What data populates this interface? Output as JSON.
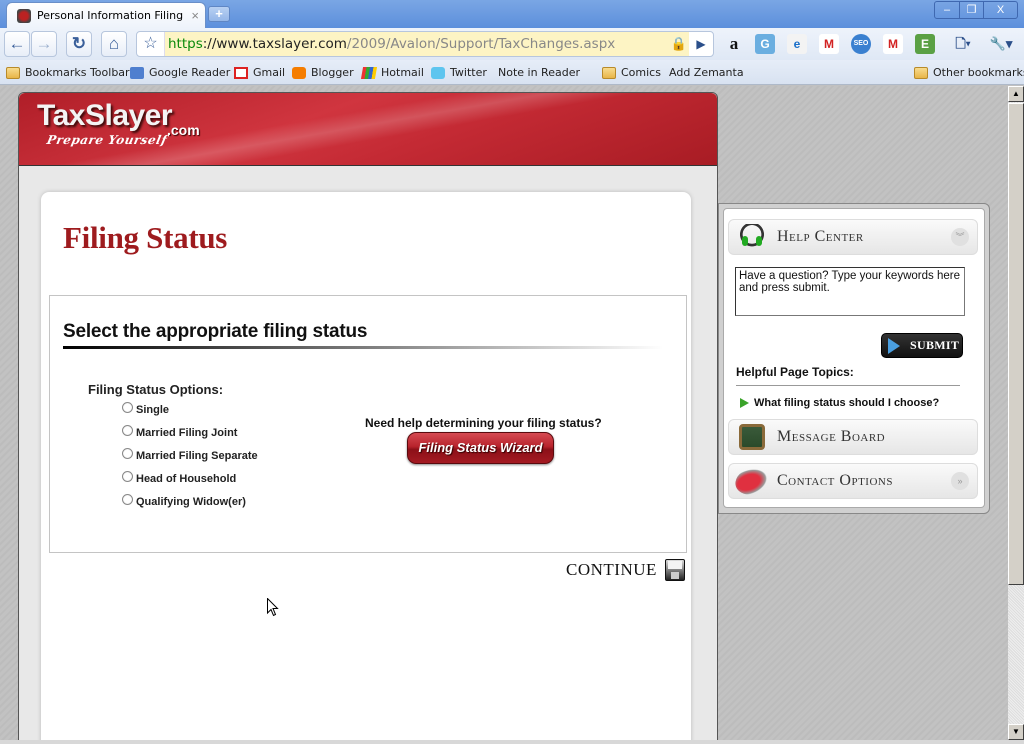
{
  "browser": {
    "tab_title": "Personal Information Filing ...",
    "tab_close": "×",
    "new_tab": "+",
    "window_controls": {
      "minimize": "–",
      "restore": "❐",
      "close": "X"
    },
    "nav": {
      "back": "←",
      "forward": "→",
      "reload": "↻",
      "home": "⌂"
    },
    "bookmark_star": "☆",
    "url": {
      "scheme": "https",
      "host": "://www.taxslayer.com",
      "path": "/2009/Avalon/Support/TaxChanges.aspx"
    },
    "lock": "🔒",
    "go": "▶",
    "extensions": [
      {
        "name": "amazon",
        "glyph": "a",
        "color": "#111111",
        "bg": "transparent"
      },
      {
        "name": "google-reader",
        "glyph": "G",
        "color": "#ffffff",
        "bg": "#6aaee0"
      },
      {
        "name": "ie-tab",
        "glyph": "e",
        "color": "#1a6fc9",
        "bg": "#f3f3f3"
      },
      {
        "name": "gmail-checker",
        "glyph": "M",
        "color": "#d22222",
        "bg": "#ffffff"
      },
      {
        "name": "seo",
        "glyph": "SEO",
        "color": "#ffffff",
        "bg": "#3a80d0"
      },
      {
        "name": "gmail-notifier",
        "glyph": "M",
        "color": "#d22222",
        "bg": "#ffffff"
      },
      {
        "name": "evernote",
        "glyph": "E",
        "color": "#ffffff",
        "bg": "#5aa044"
      },
      {
        "name": "page-menu",
        "glyph": "🗋▾",
        "color": "#2b4f8a",
        "bg": "transparent"
      },
      {
        "name": "wrench-menu",
        "glyph": "🔧▾",
        "color": "#2b4f8a",
        "bg": "transparent"
      }
    ],
    "bookmarks": [
      {
        "label": "Bookmarks Toolbar",
        "icon": "folder"
      },
      {
        "label": "Google Reader",
        "icon": "rss"
      },
      {
        "label": "Gmail",
        "icon": "gmail"
      },
      {
        "label": "Blogger",
        "icon": "blogger"
      },
      {
        "label": "Hotmail",
        "icon": "hotmail"
      },
      {
        "label": "Twitter",
        "icon": "twitter"
      },
      {
        "label": "Note in Reader",
        "icon": "page"
      },
      {
        "label": "Comics",
        "icon": "folder"
      },
      {
        "label": "Add Zemanta",
        "icon": "page"
      }
    ],
    "other_bookmarks": "Other bookmarks",
    "scrollbar": {
      "up": "▲",
      "down": "▼"
    }
  },
  "site": {
    "logo": {
      "name": "TaxSlayer",
      "domain": ".com",
      "tagline": "Prepare Yourself"
    },
    "page_title": "Filing Status",
    "section_heading": "Select the appropriate filing status",
    "options_label": "Filing Status Options:",
    "options": [
      {
        "label": "Single",
        "selected": false
      },
      {
        "label": "Married Filing Joint",
        "selected": false
      },
      {
        "label": "Married Filing Separate",
        "selected": false
      },
      {
        "label": "Head of Household",
        "selected": false
      },
      {
        "label": "Qualifying Widow(er)",
        "selected": false
      }
    ],
    "help_question": "Need help determining your filing status?",
    "wizard_button": "Filing Status Wizard",
    "continue_label": "CONTINUE",
    "brand_color": "#9e1b1e"
  },
  "sidebar": {
    "help_center": {
      "title": "Help Center",
      "input_value": "Have a question? Type your keywords here and press submit.",
      "submit_label": "SUBMIT",
      "chevron": "︾"
    },
    "topics_heading": "Helpful Page Topics:",
    "topics": [
      {
        "label": "What filing status should I choose?"
      }
    ],
    "message_board": {
      "title": "Message Board"
    },
    "contact_options": {
      "title": "Contact Options",
      "chevron": "»"
    }
  }
}
